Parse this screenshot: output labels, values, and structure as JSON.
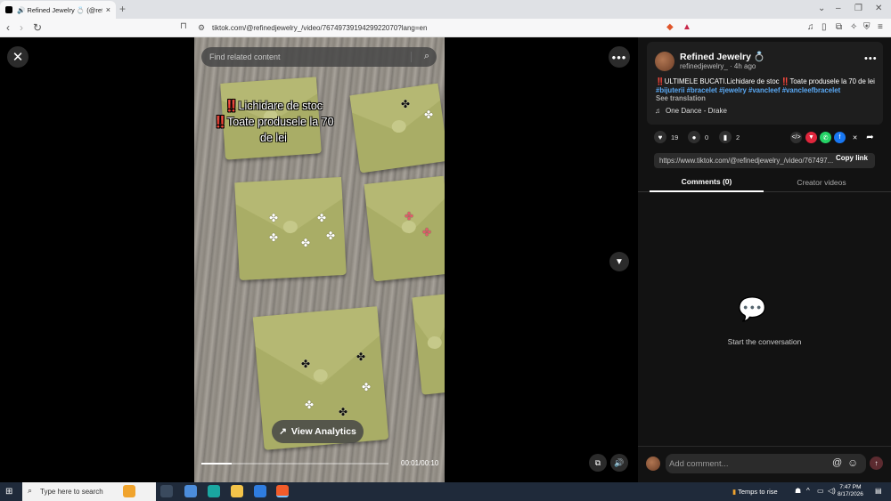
{
  "browser": {
    "tab_title": "🔊 Refined Jewelry 💍 (@refinedjewelry_)",
    "tab_close": "×",
    "new_tab": "+",
    "url": "tiktok.com/@refinedjewelry_/video/7674973919429922070?lang=en",
    "window_controls": {
      "minimize": "–",
      "restore": "❐",
      "close": "✕"
    }
  },
  "page": {
    "search_placeholder": "Find related content",
    "close_icon": "✕",
    "more_icon": "•••",
    "scroll_down_icon": "▼"
  },
  "video": {
    "overlay_line1": "Lichidare de stoc",
    "overlay_line2": "Toate produsele la 70",
    "overlay_line3": "de lei",
    "overlay_mark": "‼️",
    "analytics_label": "View Analytics",
    "time": "00:01/00:10",
    "progress_fraction": 0.16
  },
  "panel": {
    "account_name": "Refined Jewelry 💍",
    "account_handle_time": "refinedjewelry_ · 4h ago",
    "description_prefix": "‼️",
    "description_a": "ULTIMELE BUCATI.Lichidare de stoc ",
    "description_b": "Toate produsele la 70 de lei",
    "hashtags": "#bijuterii #bracelet #jewelry #vancleef #vancleefbracelet",
    "see_translation": "See translation",
    "music": "One Dance - Drake",
    "likes": "19",
    "comments": "0",
    "saves": "2",
    "link": "https://www.tiktok.com/@refinedjewelry_/video/767497...",
    "copy_link": "Copy link",
    "tab_comments": "Comments (0)",
    "tab_creator": "Creator videos",
    "empty_text": "Start the conversation",
    "comment_placeholder": "Add comment..."
  },
  "taskbar": {
    "search_placeholder": "Type here to search",
    "weather": "Temps to rise",
    "time": "7:47 PM",
    "date": "8/17/2026"
  },
  "colors": {
    "accent_red": "#e0263c",
    "hashtag_blue": "#5aa9f5",
    "panel_bg": "#121212",
    "card_bg": "#1e1e1e"
  }
}
